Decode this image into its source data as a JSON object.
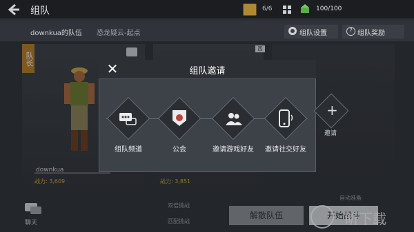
{
  "topbar": {
    "back_icon": "back-arrow-icon",
    "title": "组队",
    "chest_count": "6/6",
    "energy": "100/100"
  },
  "header": {
    "team_name": "downkua的队伍",
    "stage": "恐龙疑云-起点",
    "settings": "组队设置",
    "reward": "组队奖励"
  },
  "slots": {
    "leader_badge": "队长",
    "player_name": "downkua",
    "power1": "战力: 3,609",
    "power2": "战力: 3,851",
    "flag": "西"
  },
  "bottom": {
    "chat": "聊天",
    "opt1": "双倍挑战",
    "opt2": "匹配挑战",
    "auto_ready": "自动准备",
    "disband": "解散队伍",
    "start": "开始战斗",
    "watermark": "昕下载"
  },
  "modal": {
    "title": "组队邀请",
    "options": [
      {
        "label": "组队频道",
        "icon": "chat-bubble-icon"
      },
      {
        "label": "公会",
        "icon": "guild-emblem-icon"
      },
      {
        "label": "邀请游戏好友",
        "icon": "friends-icon"
      },
      {
        "label": "邀请社交好友",
        "icon": "phone-icon"
      }
    ],
    "invite_label": "邀请"
  }
}
